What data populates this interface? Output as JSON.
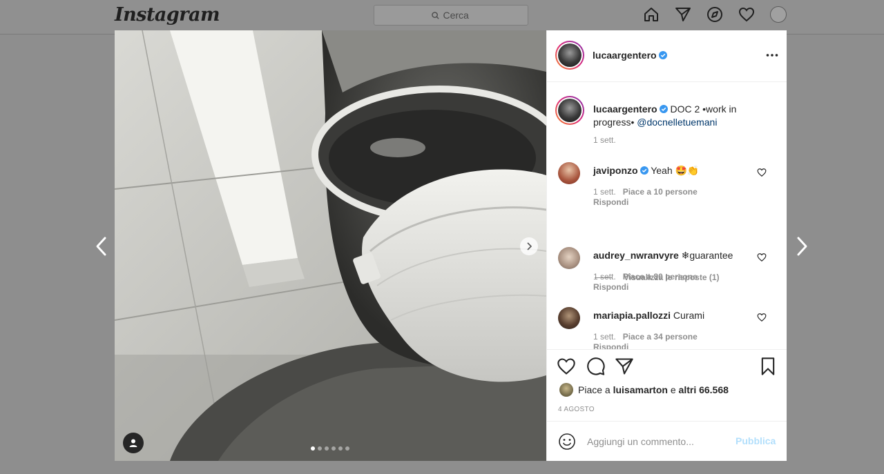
{
  "header": {
    "logo_text": "Instagram",
    "search_placeholder": "Cerca",
    "icons": [
      "home-icon",
      "direct-icon",
      "explore-icon",
      "activity-heart-icon",
      "profile-avatar"
    ]
  },
  "post": {
    "author": "lucaargentero",
    "verified": true,
    "carousel": {
      "slide_count": 6,
      "active_index": 0
    },
    "caption": {
      "user": "lucaargentero",
      "text": " DOC 2 •work in progress• ",
      "mention": "@docnelletuemani",
      "time": "1 sett."
    },
    "comments": [
      {
        "user": "javiponzo",
        "verified": true,
        "text": " Yeah 🤩👏",
        "time": "1 sett.",
        "likes": "Piace a 10 persone",
        "reply": "Rispondi",
        "view_replies": "Visualizza le risposte (1)"
      },
      {
        "user": "audrey_nwranvyre",
        "verified": false,
        "text": " ❄guarantee",
        "time": "1 sett.",
        "likes": "Piace a 80 persone",
        "reply": "Rispondi"
      },
      {
        "user": "mariapia.pallozzi",
        "verified": false,
        "text": " Curami",
        "time": "1 sett.",
        "likes": "Piace a 34 persone",
        "reply": "Rispondi"
      }
    ],
    "likes_summary": {
      "prefix": "Piace a ",
      "user": "luisamarton",
      "middle": " e ",
      "others": "altri 66.568"
    },
    "date": "4 AGOSTO",
    "add_comment": {
      "placeholder": "Aggiungi un commento...",
      "publish_label": "Pubblica"
    }
  },
  "colors": {
    "mention": "#00376b",
    "verified": "#3897f0",
    "publish_disabled": "#b2dffc",
    "overlay": "#8e8e8e"
  }
}
